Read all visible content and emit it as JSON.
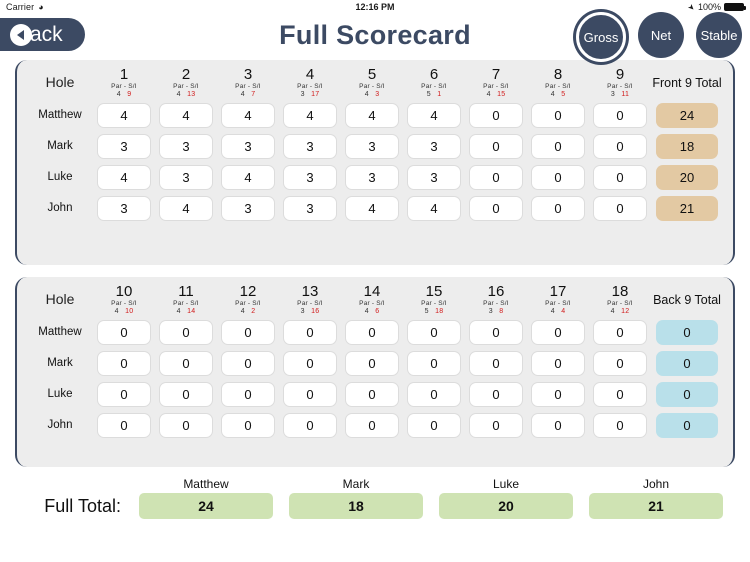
{
  "status_bar": {
    "carrier": "Carrier",
    "wifi_icon": "wifi-icon",
    "time": "12:16 PM",
    "location_icon": "location-arrow-icon",
    "battery_percent": "100%"
  },
  "nav": {
    "back_label": "Back",
    "title": "Full Scorecard",
    "modes": [
      {
        "label": "Gross",
        "selected": true
      },
      {
        "label": "Net",
        "selected": false
      },
      {
        "label": "Stable",
        "selected": false
      }
    ]
  },
  "colors": {
    "navy": "#3c4a63",
    "panel_bg": "#ededed",
    "front_total_bg": "#e3c9a3",
    "back_total_bg": "#b9e0ea",
    "full_total_bg": "#cfe3b3",
    "si_red": "#d11a1a"
  },
  "labels": {
    "hole": "Hole",
    "par_si": "Par  -  S/I",
    "front_total": "Front 9 Total",
    "back_total": "Back 9 Total",
    "full_total": "Full Total:"
  },
  "players": [
    "Matthew",
    "Mark",
    "Luke",
    "John"
  ],
  "front_nine": {
    "title": "Front 9 Total",
    "holes": [
      {
        "number": "1",
        "par": "4",
        "si": "9"
      },
      {
        "number": "2",
        "par": "4",
        "si": "13"
      },
      {
        "number": "3",
        "par": "4",
        "si": "7"
      },
      {
        "number": "4",
        "par": "3",
        "si": "17"
      },
      {
        "number": "5",
        "par": "4",
        "si": "3"
      },
      {
        "number": "6",
        "par": "5",
        "si": "1"
      },
      {
        "number": "7",
        "par": "4",
        "si": "15"
      },
      {
        "number": "8",
        "par": "4",
        "si": "5"
      },
      {
        "number": "9",
        "par": "3",
        "si": "11"
      }
    ],
    "rows": [
      {
        "player": "Matthew",
        "scores": [
          "4",
          "4",
          "4",
          "4",
          "4",
          "4",
          "0",
          "0",
          "0"
        ],
        "total": "24"
      },
      {
        "player": "Mark",
        "scores": [
          "3",
          "3",
          "3",
          "3",
          "3",
          "3",
          "0",
          "0",
          "0"
        ],
        "total": "18"
      },
      {
        "player": "Luke",
        "scores": [
          "4",
          "3",
          "4",
          "3",
          "3",
          "3",
          "0",
          "0",
          "0"
        ],
        "total": "20"
      },
      {
        "player": "John",
        "scores": [
          "3",
          "4",
          "3",
          "3",
          "4",
          "4",
          "0",
          "0",
          "0"
        ],
        "total": "21"
      }
    ]
  },
  "back_nine": {
    "title": "Back 9 Total",
    "holes": [
      {
        "number": "10",
        "par": "4",
        "si": "10"
      },
      {
        "number": "11",
        "par": "4",
        "si": "14"
      },
      {
        "number": "12",
        "par": "4",
        "si": "2"
      },
      {
        "number": "13",
        "par": "3",
        "si": "16"
      },
      {
        "number": "14",
        "par": "4",
        "si": "6"
      },
      {
        "number": "15",
        "par": "5",
        "si": "18"
      },
      {
        "number": "16",
        "par": "3",
        "si": "8"
      },
      {
        "number": "17",
        "par": "4",
        "si": "4"
      },
      {
        "number": "18",
        "par": "4",
        "si": "12"
      }
    ],
    "rows": [
      {
        "player": "Matthew",
        "scores": [
          "0",
          "0",
          "0",
          "0",
          "0",
          "0",
          "0",
          "0",
          "0"
        ],
        "total": "0"
      },
      {
        "player": "Mark",
        "scores": [
          "0",
          "0",
          "0",
          "0",
          "0",
          "0",
          "0",
          "0",
          "0"
        ],
        "total": "0"
      },
      {
        "player": "Luke",
        "scores": [
          "0",
          "0",
          "0",
          "0",
          "0",
          "0",
          "0",
          "0",
          "0"
        ],
        "total": "0"
      },
      {
        "player": "John",
        "scores": [
          "0",
          "0",
          "0",
          "0",
          "0",
          "0",
          "0",
          "0",
          "0"
        ],
        "total": "0"
      }
    ]
  },
  "footer": {
    "label": "Full Total:",
    "totals": [
      {
        "player": "Matthew",
        "value": "24"
      },
      {
        "player": "Mark",
        "value": "18"
      },
      {
        "player": "Luke",
        "value": "20"
      },
      {
        "player": "John",
        "value": "21"
      }
    ]
  }
}
